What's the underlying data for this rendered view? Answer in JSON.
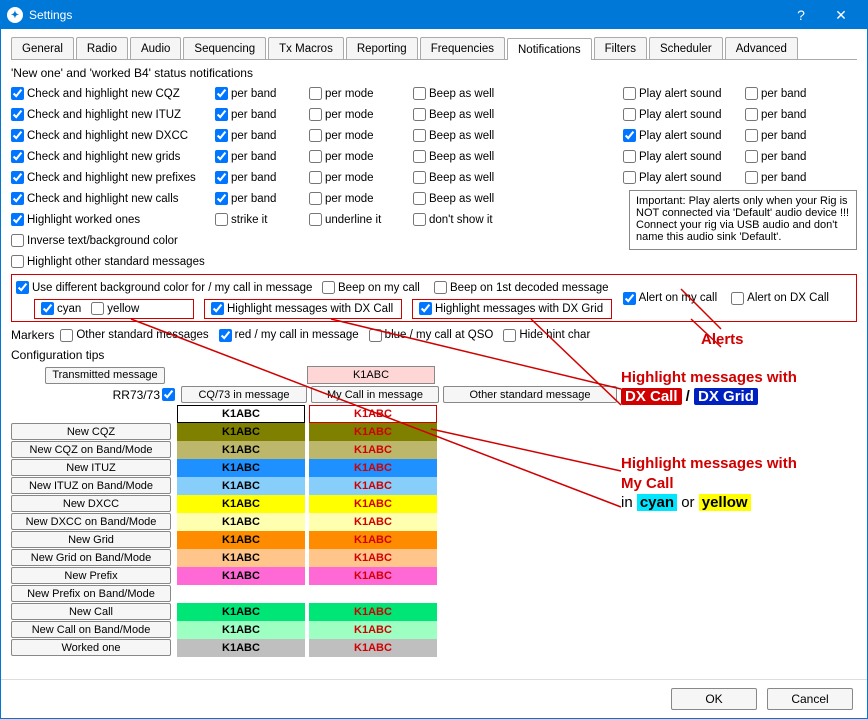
{
  "window": {
    "title": "Settings"
  },
  "tabs": [
    "General",
    "Radio",
    "Audio",
    "Sequencing",
    "Tx Macros",
    "Reporting",
    "Frequencies",
    "Notifications",
    "Filters",
    "Scheduler",
    "Advanced"
  ],
  "active_tab": "Notifications",
  "section_title": "'New one' and 'worked B4' status notifications",
  "main_rows": [
    {
      "label": "Check and highlight new CQZ",
      "c1": true,
      "pb": true,
      "pm": false,
      "beep": false,
      "play": false,
      "pb2": false
    },
    {
      "label": "Check and highlight new ITUZ",
      "c1": true,
      "pb": true,
      "pm": false,
      "beep": false,
      "play": false,
      "pb2": false
    },
    {
      "label": "Check and highlight new DXCC",
      "c1": true,
      "pb": true,
      "pm": false,
      "beep": false,
      "play": true,
      "pb2": false
    },
    {
      "label": "Check and highlight new grids",
      "c1": true,
      "pb": true,
      "pm": false,
      "beep": false,
      "play": false,
      "pb2": false
    },
    {
      "label": "Check and highlight new prefixes",
      "c1": true,
      "pb": true,
      "pm": false,
      "beep": false,
      "play": false,
      "pb2": false
    },
    {
      "label": "Check and highlight new calls",
      "c1": true,
      "pb": true,
      "pm": false,
      "beep": false
    }
  ],
  "col_labels": {
    "per_band": "per band",
    "per_mode": "per mode",
    "beep": "Beep as well",
    "play": "Play alert sound"
  },
  "highlight_worked": {
    "label": "Highlight worked ones",
    "c": true,
    "strike": "strike it",
    "strike_c": false,
    "underline": "underline it",
    "under_c": false,
    "dont": "don't show it",
    "dont_c": false
  },
  "inverse": {
    "label": "Inverse text/background color",
    "c": false
  },
  "hl_other_std": {
    "label": "Highlight other standard messages",
    "c": false
  },
  "important_note": "Important: Play alerts only when your Rig is NOT connected via 'Default' audio device !!! Connect your rig via USB audio and don't name this audio sink 'Default'.",
  "diff_bg": {
    "label": "Use different background color for / my call in message",
    "c": true,
    "cyan": "cyan",
    "cyan_c": true,
    "yellow": "yellow",
    "yellow_c": false,
    "hl_dx_call": "Highlight messages with DX Call",
    "hl_dx_call_c": true,
    "hl_dx_grid": "Highlight messages with DX Grid",
    "hl_dx_grid_c": true,
    "beep_my": "Beep on my call",
    "beep_my_c": false,
    "beep_1st": "Beep on 1st decoded message",
    "beep_1st_c": false,
    "alert_my": "Alert on my call",
    "alert_my_c": true,
    "alert_dx": "Alert on DX Call",
    "alert_dx_c": false
  },
  "markers": {
    "label": "Markers",
    "other_std": "Other standard messages",
    "other_std_c": false,
    "red_my": "red / my call in message",
    "red_my_c": true,
    "blue": "blue / my call at QSO",
    "blue_c": false,
    "hide": "Hide hint char",
    "hide_c": false
  },
  "config_tips": "Configuration tips",
  "headers": {
    "transmitted": "Transmitted message",
    "rr73": "RR73/73",
    "rr73_c": true,
    "cq73": "CQ/73 in message",
    "mycall": "My Call in message",
    "other": "Other standard message",
    "sample": "K1ABC"
  },
  "color_rows": [
    {
      "label": "",
      "bg1": "#ffffff",
      "fg1": "#000",
      "bg2": "#ffffff",
      "fg2": "#d00000"
    },
    {
      "label": "New CQZ",
      "bg1": "#808000",
      "fg1": "#000",
      "bg2": "#808000",
      "fg2": "#d00000"
    },
    {
      "label": "New CQZ on Band/Mode",
      "bg1": "#bdb76b",
      "fg1": "#000",
      "bg2": "#bdb76b",
      "fg2": "#d00000"
    },
    {
      "label": "New ITUZ",
      "bg1": "#1e90ff",
      "fg1": "#000",
      "bg2": "#1e90ff",
      "fg2": "#d00000"
    },
    {
      "label": "New ITUZ on Band/Mode",
      "bg1": "#87cefa",
      "fg1": "#000",
      "bg2": "#87cefa",
      "fg2": "#d00000"
    },
    {
      "label": "New DXCC",
      "bg1": "#ffff00",
      "fg1": "#000",
      "bg2": "#ffff00",
      "fg2": "#d00000"
    },
    {
      "label": "New DXCC on Band/Mode",
      "bg1": "#ffffb0",
      "fg1": "#000",
      "bg2": "#ffffb0",
      "fg2": "#d00000"
    },
    {
      "label": "New Grid",
      "bg1": "#ff8c00",
      "fg1": "#000",
      "bg2": "#ff8c00",
      "fg2": "#d00000"
    },
    {
      "label": "New Grid on Band/Mode",
      "bg1": "#ffc58a",
      "fg1": "#000",
      "bg2": "#ffc58a",
      "fg2": "#d00000"
    },
    {
      "label": "New Prefix",
      "bg1": "#ff69d6",
      "fg1": "#000",
      "bg2": "#ff69d6",
      "fg2": "#d00000"
    },
    {
      "label": "New Prefix on Band/Mode",
      "bg1": "none",
      "fg1": "#000",
      "bg2": "none",
      "fg2": "#d00000",
      "empty": true
    },
    {
      "label": "New Call",
      "bg1": "#00e676",
      "fg1": "#000",
      "bg2": "#00e676",
      "fg2": "#d00000"
    },
    {
      "label": "New Call on Band/Mode",
      "bg1": "#9effc3",
      "fg1": "#000",
      "bg2": "#9effc3",
      "fg2": "#d00000"
    },
    {
      "label": "Worked one",
      "bg1": "#bfbfbf",
      "fg1": "#000",
      "bg2": "#bfbfbf",
      "fg2": "#d00000"
    }
  ],
  "annotations": {
    "alerts": "Alerts",
    "hl_dx": "Highlight messages with",
    "dx_call": "DX Call",
    "dx_grid": "DX Grid",
    "slash": " / ",
    "hl_my": "Highlight messages with",
    "my_call_line": "My Call",
    "in": "in ",
    "or": "  or  ",
    "cyan": "cyan",
    "yellow": "yellow"
  },
  "footer": {
    "ok": "OK",
    "cancel": "Cancel"
  }
}
